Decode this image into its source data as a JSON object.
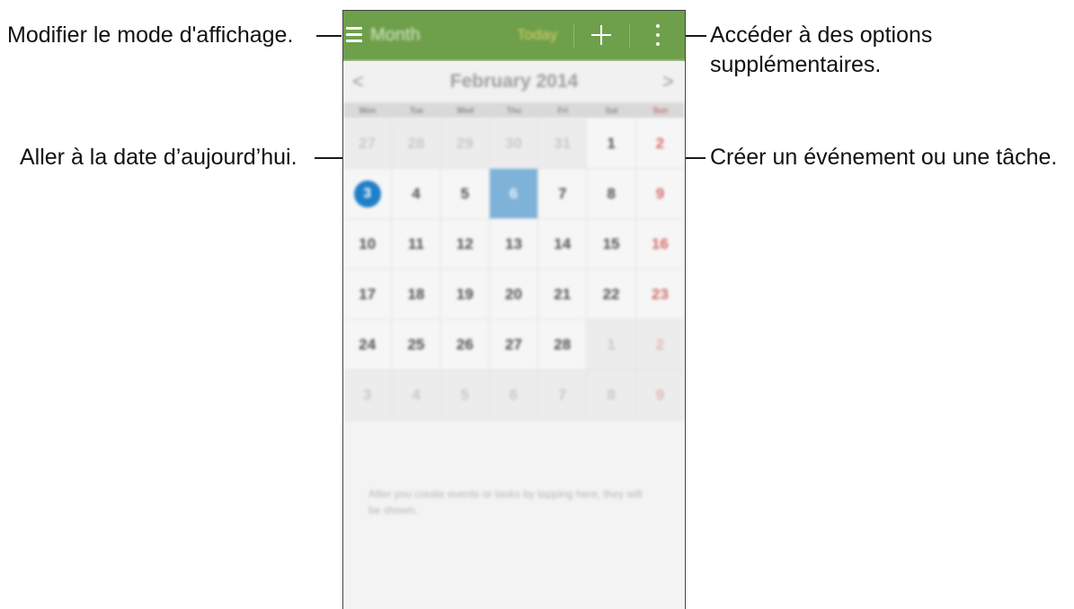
{
  "callouts": {
    "view_mode": "Modifier le mode d'affichage.",
    "more_options_line1": "Accéder à des options",
    "more_options_line2": "supplémentaires.",
    "go_today": "Aller à la date d’aujourd’hui.",
    "create_event": "Créer un événement ou une tâche."
  },
  "appbar": {
    "menu_icon": "hamburger-menu-icon",
    "title": "Month",
    "today_label": "Today",
    "add_icon": "plus-icon",
    "more_icon": "overflow-menu-icon",
    "background_color": "#6e9f4a"
  },
  "month_nav": {
    "prev": "<",
    "label": "February 2014",
    "next": ">"
  },
  "weekdays": [
    "Mon",
    "Tue",
    "Wed",
    "Thu",
    "Fri",
    "Sat",
    "Sun"
  ],
  "weeks": [
    [
      {
        "d": "27",
        "other": true
      },
      {
        "d": "28",
        "other": true
      },
      {
        "d": "29",
        "other": true
      },
      {
        "d": "30",
        "other": true
      },
      {
        "d": "31",
        "other": true
      },
      {
        "d": "1"
      },
      {
        "d": "2"
      }
    ],
    [
      {
        "d": "3",
        "today": true
      },
      {
        "d": "4"
      },
      {
        "d": "5"
      },
      {
        "d": "6",
        "selected": true
      },
      {
        "d": "7"
      },
      {
        "d": "8"
      },
      {
        "d": "9"
      }
    ],
    [
      {
        "d": "10"
      },
      {
        "d": "11"
      },
      {
        "d": "12"
      },
      {
        "d": "13"
      },
      {
        "d": "14"
      },
      {
        "d": "15"
      },
      {
        "d": "16"
      }
    ],
    [
      {
        "d": "17"
      },
      {
        "d": "18"
      },
      {
        "d": "19"
      },
      {
        "d": "20"
      },
      {
        "d": "21"
      },
      {
        "d": "22"
      },
      {
        "d": "23"
      }
    ],
    [
      {
        "d": "24"
      },
      {
        "d": "25"
      },
      {
        "d": "26"
      },
      {
        "d": "27"
      },
      {
        "d": "28"
      },
      {
        "d": "1",
        "other": true
      },
      {
        "d": "2",
        "other": true
      }
    ],
    [
      {
        "d": "3",
        "other": true
      },
      {
        "d": "4",
        "other": true
      },
      {
        "d": "5",
        "other": true
      },
      {
        "d": "6",
        "other": true
      },
      {
        "d": "7",
        "other": true
      },
      {
        "d": "8",
        "other": true
      },
      {
        "d": "9",
        "other": true
      }
    ]
  ],
  "empty_message": "After you create events or tasks by tapping here, they will be shown.",
  "colors": {
    "today_circle": "#1f7fc8",
    "selected_cell": "#7eb2d8",
    "sunday_text": "#d06b6b"
  }
}
